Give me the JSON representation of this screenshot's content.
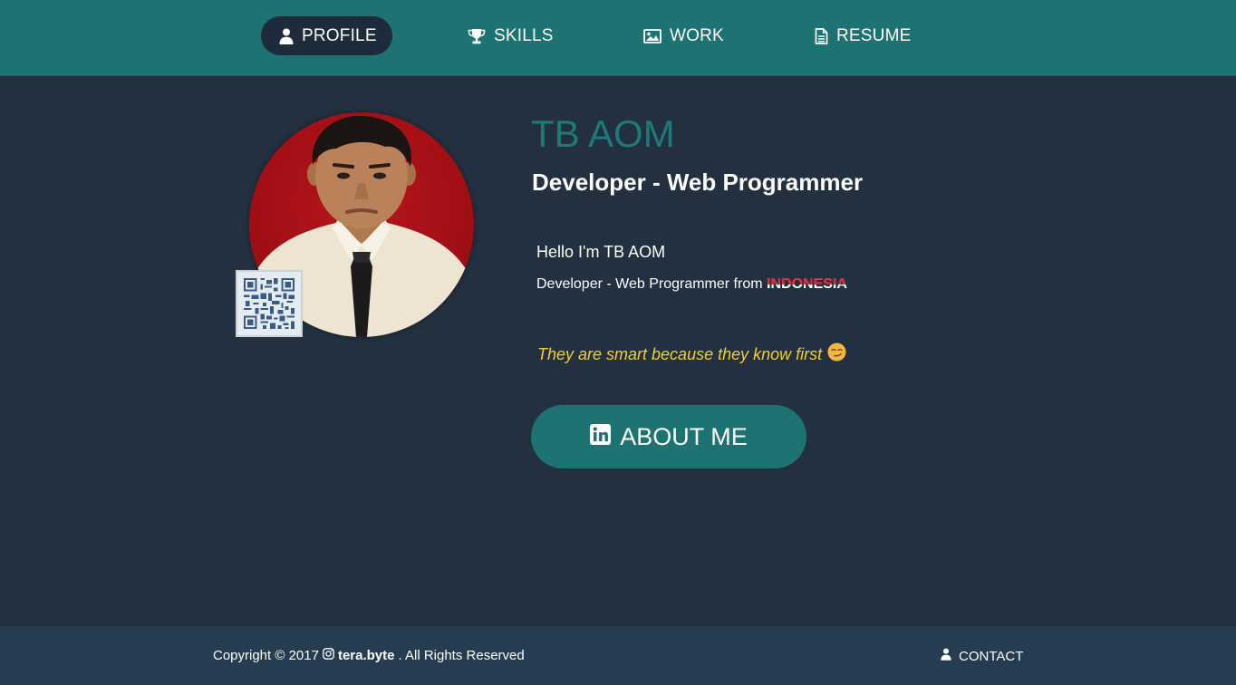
{
  "nav": {
    "items": [
      {
        "label": "PROFILE",
        "icon": "user-icon",
        "active": true
      },
      {
        "label": "SKILLS",
        "icon": "trophy-icon",
        "active": false
      },
      {
        "label": "WORK",
        "icon": "image-icon",
        "active": false
      },
      {
        "label": "RESUME",
        "icon": "document-icon",
        "active": false
      }
    ]
  },
  "profile": {
    "name": "TB AOM",
    "role": "Developer - Web Programmer",
    "hello": "Hello I'm TB AOM",
    "from_prefix": "Developer - Web Programmer from",
    "country": "INDONESIA",
    "quote": "They are smart because they know first",
    "quote_emoji": "😏",
    "about_button": "ABOUT ME",
    "about_icon": "linkedin-icon"
  },
  "footer": {
    "copyright_prefix": "Copyright © 2017",
    "brand": "tera.byte",
    "copyright_suffix": ". All Rights Reserved",
    "brand_icon": "instagram-icon",
    "contact_label": "CONTACT",
    "contact_icon": "user-icon"
  },
  "colors": {
    "nav_bg": "#1c7371",
    "page_bg": "#22303f",
    "footer_bg": "#263d51",
    "accent": "#1d7a78",
    "quote": "#f2d02c",
    "country_red": "#e8212f"
  }
}
